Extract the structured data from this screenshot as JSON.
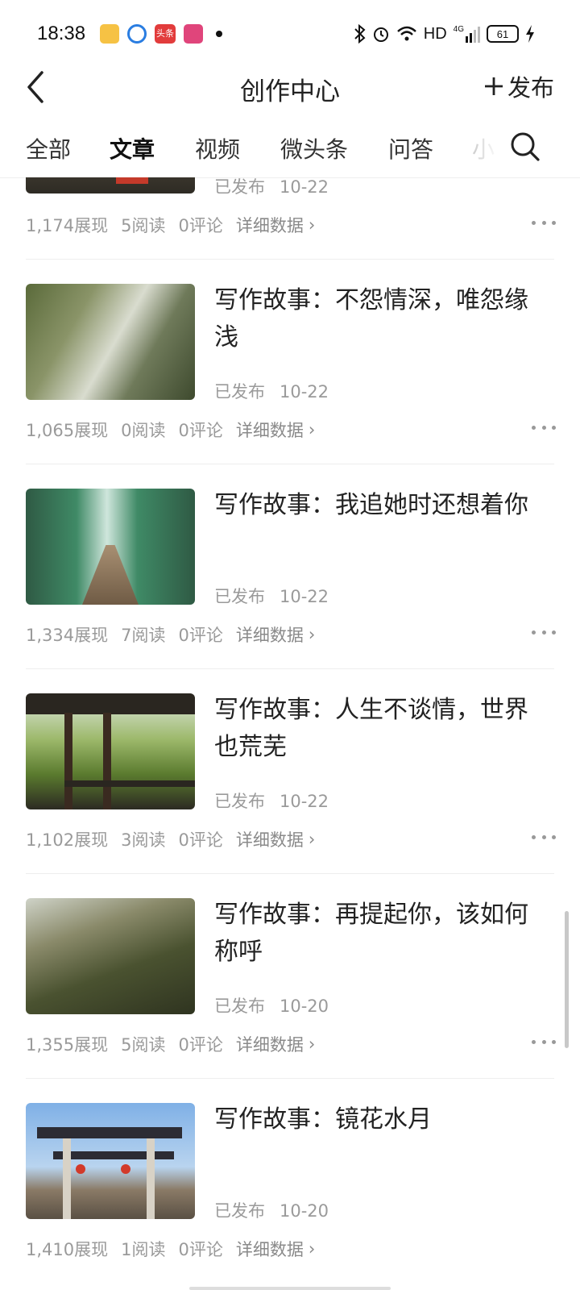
{
  "status_bar": {
    "time": "18:38",
    "network": "HD",
    "signal": "4G",
    "battery": "61",
    "app_icons": [
      {
        "name": "notes-app-icon",
        "color": "#f6c244"
      },
      {
        "name": "browser-app-icon",
        "color": "#2a7de1"
      },
      {
        "name": "toutiao-app-icon",
        "color": "#e23c3c",
        "label": "头条"
      },
      {
        "name": "pink-app-icon",
        "color": "#e0457b"
      }
    ]
  },
  "nav": {
    "title": "创作中心",
    "publish_label": "发布"
  },
  "tabs": [
    "全部",
    "文章",
    "视频",
    "微头条",
    "问答",
    "小"
  ],
  "active_tab": "文章",
  "detail_label": "详细数据",
  "articles": [
    {
      "title": "",
      "status": "已发布",
      "date": "10-22",
      "views": "1,174展现",
      "reads": "5阅读",
      "comments": "0评论"
    },
    {
      "title": "写作故事：不怨情深，唯怨缘浅",
      "status": "已发布",
      "date": "10-22",
      "views": "1,065展现",
      "reads": "0阅读",
      "comments": "0评论"
    },
    {
      "title": "写作故事：我追她时还想着你",
      "status": "已发布",
      "date": "10-22",
      "views": "1,334展现",
      "reads": "7阅读",
      "comments": "0评论"
    },
    {
      "title": "写作故事：人生不谈情，世界也荒芜",
      "status": "已发布",
      "date": "10-22",
      "views": "1,102展现",
      "reads": "3阅读",
      "comments": "0评论"
    },
    {
      "title": "写作故事：再提起你，该如何称呼",
      "status": "已发布",
      "date": "10-20",
      "views": "1,355展现",
      "reads": "5阅读",
      "comments": "0评论"
    },
    {
      "title": "写作故事：镜花水月",
      "status": "已发布",
      "date": "10-20",
      "views": "1,410展现",
      "reads": "1阅读",
      "comments": "0评论"
    }
  ]
}
